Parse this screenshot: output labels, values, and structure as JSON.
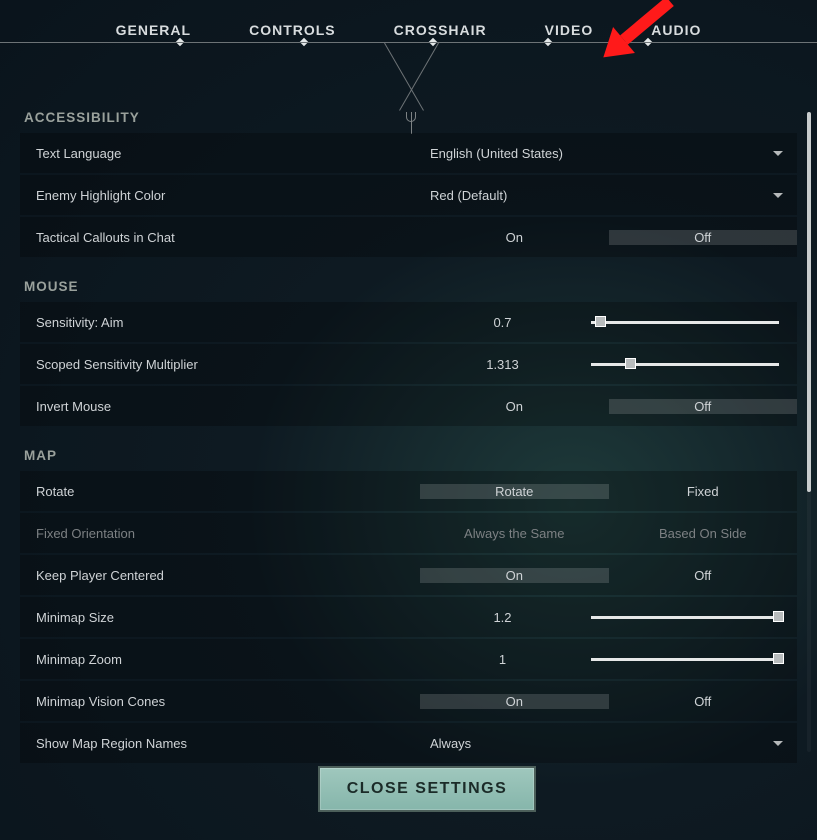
{
  "tabs": [
    "GENERAL",
    "CONTROLS",
    "CROSSHAIR",
    "VIDEO",
    "AUDIO"
  ],
  "close_label": "CLOSE SETTINGS",
  "sections": {
    "accessibility": {
      "title": "ACCESSIBILITY",
      "text_language_label": "Text Language",
      "text_language_value": "English (United States)",
      "enemy_color_label": "Enemy Highlight Color",
      "enemy_color_value": "Red (Default)",
      "tactical_callouts_label": "Tactical Callouts in Chat",
      "on": "On",
      "off": "Off"
    },
    "mouse": {
      "title": "MOUSE",
      "sens_label": "Sensitivity: Aim",
      "sens_value": "0.7",
      "scoped_label": "Scoped Sensitivity Multiplier",
      "scoped_value": "1.313",
      "invert_label": "Invert Mouse",
      "on": "On",
      "off": "Off"
    },
    "map": {
      "title": "MAP",
      "rotate_label": "Rotate",
      "rotate_opt": "Rotate",
      "fixed_opt": "Fixed",
      "fixed_orient_label": "Fixed Orientation",
      "always_same": "Always the Same",
      "based_on_side": "Based On Side",
      "keep_centered_label": "Keep Player Centered",
      "minimap_size_label": "Minimap Size",
      "minimap_size_value": "1.2",
      "minimap_zoom_label": "Minimap Zoom",
      "minimap_zoom_value": "1",
      "vision_cones_label": "Minimap Vision Cones",
      "region_names_label": "Show Map Region Names",
      "region_names_value": "Always",
      "on": "On",
      "off": "Off"
    }
  }
}
